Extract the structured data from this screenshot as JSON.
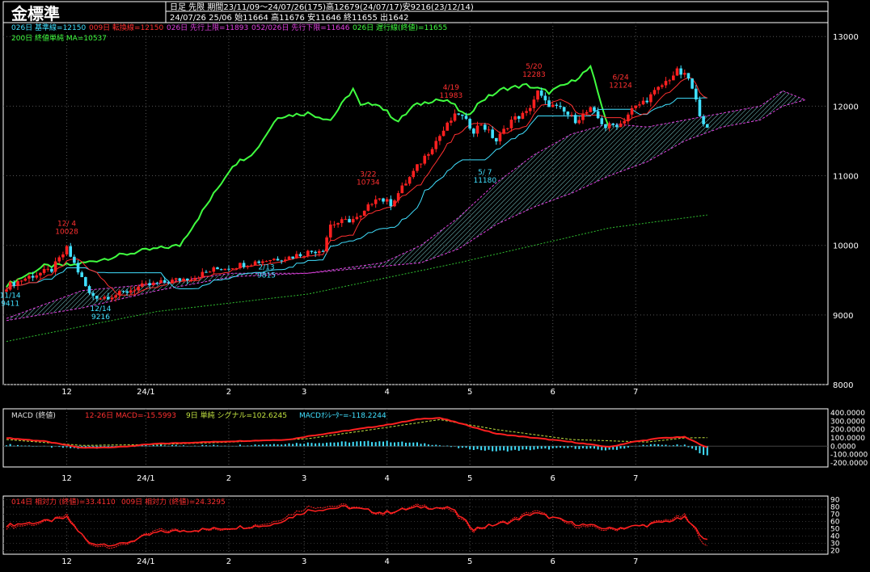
{
  "header": {
    "title": "金標準",
    "line1": "日足 先限 期間23/11/09～24/07/26(175)高12679(24/07/17)安9216(23/12/14)",
    "line2": "24/07/26 25/06 始11664 高11676 安11646 終11655 出1642"
  },
  "legend_main": [
    {
      "text": "026日 基準線=12150",
      "color": "#40e0ff"
    },
    {
      "text": "009日 転換線=12150",
      "color": "#ff3030"
    },
    {
      "text": "026日 先行上限=11893",
      "color": "#e040e0"
    },
    {
      "text": "052/026日 先行下限=11646",
      "color": "#e040e0"
    },
    {
      "text": "026日 遅行線(終値)=11655",
      "color": "#40ff40"
    },
    {
      "text": "200日 終値単純 MA=10537",
      "color": "#40ff40"
    }
  ],
  "legend_macd": [
    {
      "text": "MACD (終値)",
      "color": "#e0e0e0"
    },
    {
      "text": "12-26日 MACD=-15.5993",
      "color": "#ff3030"
    },
    {
      "text": "9日 単純 シグナル=102.6245",
      "color": "#c0e040"
    },
    {
      "text": "MACDｵｼﾚｰﾀｰ=-118.2244",
      "color": "#40e0ff"
    }
  ],
  "legend_rsi": [
    {
      "text": "014日 相対力 (終値)=33.4110",
      "color": "#ff3030"
    },
    {
      "text": "009日 相対力 (終値)=24.3295",
      "color": "#ff3030"
    }
  ],
  "chart_data": [
    {
      "type": "candlestick",
      "panel": "price",
      "ylim": [
        8000,
        13200
      ],
      "y_ticks": [
        "13000",
        "12000",
        "11000",
        "10000",
        "9000",
        "8000"
      ],
      "x_ticks": [
        "12",
        "24/1",
        "2",
        "3",
        "4",
        "5",
        "6",
        "7"
      ],
      "annotations": [
        {
          "text": "12/ 4",
          "value": "10028",
          "color": "#ff3030"
        },
        {
          "text": "11/14",
          "value": "9411",
          "color": "#40e0ff"
        },
        {
          "text": "12/14",
          "value": "9216",
          "color": "#40e0ff"
        },
        {
          "text": "2/13",
          "value": "9815",
          "color": "#40e0ff"
        },
        {
          "text": "3/22",
          "value": "10734",
          "color": "#ff3030"
        },
        {
          "text": "4/19",
          "value": "11983",
          "color": "#ff3030"
        },
        {
          "text": "5/ 7",
          "value": "11180",
          "color": "#40e0ff"
        },
        {
          "text": "5/20",
          "value": "12283",
          "color": "#ff3030"
        },
        {
          "text": "6/24",
          "value": "12124",
          "color": "#ff3030"
        }
      ],
      "close_anchors": [
        [
          0,
          9410
        ],
        [
          6,
          9550
        ],
        [
          12,
          9650
        ],
        [
          16,
          9950
        ],
        [
          20,
          9520
        ],
        [
          22,
          9300
        ],
        [
          25,
          9250
        ],
        [
          30,
          9300
        ],
        [
          35,
          9400
        ],
        [
          40,
          9450
        ],
        [
          45,
          9500
        ],
        [
          50,
          9550
        ],
        [
          55,
          9650
        ],
        [
          60,
          9700
        ],
        [
          65,
          9750
        ],
        [
          70,
          9800
        ],
        [
          75,
          9830
        ],
        [
          80,
          9900
        ],
        [
          84,
          9950
        ],
        [
          86,
          10300
        ],
        [
          90,
          10350
        ],
        [
          94,
          10400
        ],
        [
          98,
          10700
        ],
        [
          102,
          10600
        ],
        [
          106,
          10900
        ],
        [
          110,
          11200
        ],
        [
          114,
          11500
        ],
        [
          118,
          11800
        ],
        [
          120,
          11900
        ],
        [
          124,
          11650
        ],
        [
          126,
          11750
        ],
        [
          130,
          11500
        ],
        [
          134,
          11800
        ],
        [
          138,
          11900
        ],
        [
          141,
          12200
        ],
        [
          143,
          12050
        ],
        [
          147,
          11950
        ],
        [
          151,
          11800
        ],
        [
          155,
          11950
        ],
        [
          159,
          11700
        ],
        [
          163,
          11750
        ],
        [
          166,
          11950
        ],
        [
          170,
          12100
        ],
        [
          174,
          12300
        ],
        [
          178,
          12500
        ],
        [
          181,
          12400
        ],
        [
          184,
          11900
        ],
        [
          186,
          11655
        ]
      ],
      "ma200_anchors": [
        [
          0,
          8620
        ],
        [
          40,
          9050
        ],
        [
          80,
          9300
        ],
        [
          120,
          9750
        ],
        [
          160,
          10250
        ],
        [
          200,
          10537
        ]
      ],
      "lagging_anchors": [
        [
          0,
          9430
        ],
        [
          10,
          9700
        ],
        [
          18,
          9720
        ],
        [
          36,
          9920
        ],
        [
          46,
          10000
        ],
        [
          54,
          10650
        ],
        [
          60,
          11150
        ],
        [
          66,
          11350
        ],
        [
          72,
          11850
        ],
        [
          80,
          11900
        ],
        [
          86,
          11800
        ],
        [
          92,
          12250
        ],
        [
          94,
          12000
        ],
        [
          98,
          12050
        ],
        [
          104,
          11780
        ],
        [
          108,
          12000
        ],
        [
          114,
          12100
        ],
        [
          118,
          12050
        ],
        [
          122,
          11850
        ],
        [
          126,
          12080
        ],
        [
          132,
          12250
        ],
        [
          138,
          12300
        ],
        [
          144,
          12200
        ],
        [
          150,
          12350
        ],
        [
          155,
          12550
        ],
        [
          160,
          11655
        ]
      ],
      "cloud_upper_anchors": [
        [
          0,
          8950
        ],
        [
          20,
          9350
        ],
        [
          40,
          9450
        ],
        [
          60,
          9600
        ],
        [
          80,
          9600
        ],
        [
          100,
          9750
        ],
        [
          110,
          10000
        ],
        [
          120,
          10400
        ],
        [
          130,
          10900
        ],
        [
          140,
          11300
        ],
        [
          150,
          11600
        ],
        [
          160,
          11750
        ],
        [
          170,
          11700
        ],
        [
          180,
          11800
        ],
        [
          190,
          11900
        ],
        [
          200,
          12000
        ],
        [
          206,
          12220
        ],
        [
          212,
          12090
        ]
      ],
      "cloud_lower_anchors": [
        [
          0,
          8920
        ],
        [
          20,
          9100
        ],
        [
          40,
          9350
        ],
        [
          60,
          9550
        ],
        [
          80,
          9600
        ],
        [
          100,
          9700
        ],
        [
          110,
          9750
        ],
        [
          120,
          9950
        ],
        [
          130,
          10300
        ],
        [
          140,
          10550
        ],
        [
          150,
          10750
        ],
        [
          160,
          11000
        ],
        [
          170,
          11200
        ],
        [
          180,
          11500
        ],
        [
          190,
          11700
        ],
        [
          200,
          11800
        ],
        [
          206,
          12000
        ],
        [
          212,
          12090
        ]
      ]
    },
    {
      "type": "line",
      "panel": "macd",
      "ylim": [
        -250,
        450
      ],
      "y_ticks": [
        "400.0000",
        "300.0000",
        "200.0000",
        "100.0000",
        "0.0000",
        "-100.0000",
        "-200.0000"
      ],
      "macd_anchors": [
        [
          0,
          100
        ],
        [
          10,
          60
        ],
        [
          20,
          -20
        ],
        [
          30,
          -10
        ],
        [
          40,
          30
        ],
        [
          60,
          60
        ],
        [
          75,
          80
        ],
        [
          80,
          120
        ],
        [
          100,
          250
        ],
        [
          110,
          330
        ],
        [
          115,
          340
        ],
        [
          120,
          280
        ],
        [
          130,
          150
        ],
        [
          140,
          100
        ],
        [
          150,
          50
        ],
        [
          160,
          -10
        ],
        [
          166,
          50
        ],
        [
          174,
          100
        ],
        [
          180,
          110
        ],
        [
          186,
          -15.6
        ]
      ],
      "signal_anchors": [
        [
          0,
          80
        ],
        [
          20,
          10
        ],
        [
          40,
          20
        ],
        [
          60,
          50
        ],
        [
          80,
          90
        ],
        [
          100,
          220
        ],
        [
          115,
          320
        ],
        [
          130,
          200
        ],
        [
          150,
          80
        ],
        [
          170,
          50
        ],
        [
          180,
          100
        ],
        [
          186,
          102.6
        ]
      ],
      "osc_anchors": [
        [
          0,
          20
        ],
        [
          20,
          -30
        ],
        [
          40,
          10
        ],
        [
          60,
          10
        ],
        [
          80,
          40
        ],
        [
          100,
          60
        ],
        [
          112,
          30
        ],
        [
          120,
          -20
        ],
        [
          130,
          -60
        ],
        [
          150,
          -20
        ],
        [
          160,
          -50
        ],
        [
          170,
          20
        ],
        [
          180,
          10
        ],
        [
          186,
          -118.2
        ]
      ]
    },
    {
      "type": "line",
      "panel": "rsi",
      "ylim": [
        15,
        95
      ],
      "y_ticks": [
        "90",
        "80",
        "70",
        "60",
        "50",
        "40",
        "30",
        "20"
      ],
      "rsi14_anchors": [
        [
          0,
          55
        ],
        [
          10,
          60
        ],
        [
          16,
          65
        ],
        [
          22,
          30
        ],
        [
          30,
          28
        ],
        [
          40,
          45
        ],
        [
          55,
          50
        ],
        [
          70,
          55
        ],
        [
          80,
          75
        ],
        [
          90,
          80
        ],
        [
          100,
          72
        ],
        [
          110,
          80
        ],
        [
          118,
          78
        ],
        [
          124,
          50
        ],
        [
          134,
          60
        ],
        [
          140,
          72
        ],
        [
          150,
          58
        ],
        [
          160,
          50
        ],
        [
          170,
          55
        ],
        [
          180,
          65
        ],
        [
          186,
          33.4
        ]
      ],
      "rsi9_anchors": [
        [
          0,
          52
        ],
        [
          10,
          58
        ],
        [
          16,
          68
        ],
        [
          22,
          28
        ],
        [
          30,
          25
        ],
        [
          40,
          48
        ],
        [
          55,
          48
        ],
        [
          70,
          58
        ],
        [
          80,
          80
        ],
        [
          90,
          82
        ],
        [
          100,
          70
        ],
        [
          110,
          83
        ],
        [
          118,
          75
        ],
        [
          124,
          48
        ],
        [
          134,
          62
        ],
        [
          140,
          75
        ],
        [
          150,
          55
        ],
        [
          160,
          48
        ],
        [
          170,
          56
        ],
        [
          180,
          68
        ],
        [
          186,
          24.3
        ]
      ]
    }
  ]
}
